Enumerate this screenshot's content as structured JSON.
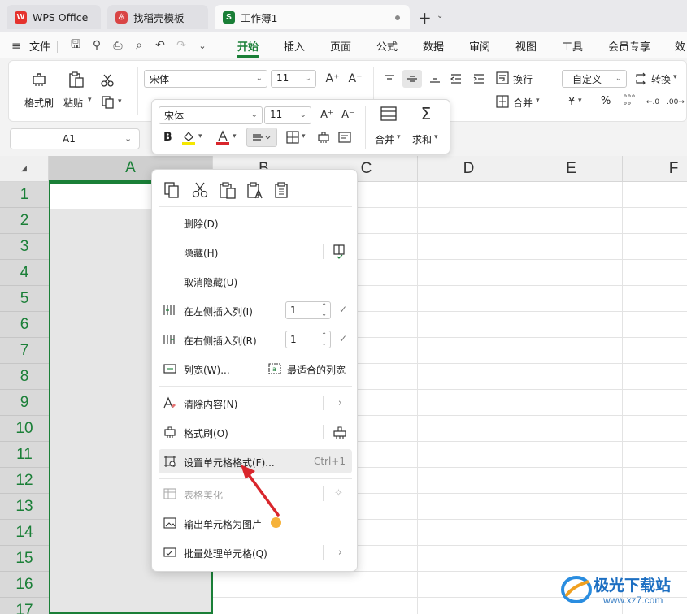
{
  "tabs": [
    {
      "label": "WPS Office"
    },
    {
      "label": "找稻壳模板"
    },
    {
      "label": "工作簿1"
    }
  ],
  "menu": {
    "file": "文件",
    "items": [
      "开始",
      "插入",
      "页面",
      "公式",
      "数据",
      "审阅",
      "视图",
      "工具",
      "会员专享",
      "效"
    ]
  },
  "ribbon": {
    "format_painter": "格式刷",
    "paste": "粘贴",
    "font_name": "宋体",
    "font_size": "11",
    "wrap": "换行",
    "merge": "合并",
    "number_format": "自定义",
    "convert": "转换",
    "yen": "¥",
    "percent": "%"
  },
  "namebox": {
    "value": "A1"
  },
  "grid": {
    "columns": [
      "A",
      "B",
      "C",
      "D",
      "E",
      "F"
    ],
    "rows": [
      "1",
      "2",
      "3",
      "4",
      "5",
      "6",
      "7",
      "8",
      "9",
      "10",
      "11",
      "12",
      "13",
      "14",
      "15",
      "16",
      "17"
    ]
  },
  "minibar": {
    "font_name": "宋体",
    "font_size": "11",
    "bold": "B",
    "merge": "合并",
    "sum": "求和"
  },
  "context_menu": {
    "delete": "删除(D)",
    "hide": "隐藏(H)",
    "unhide": "取消隐藏(U)",
    "insert_left": "在左侧插入列(I)",
    "insert_left_count": "1",
    "insert_right": "在右侧插入列(R)",
    "insert_right_count": "1",
    "col_width": "列宽(W)...",
    "best_fit": "最适合的列宽",
    "clear": "清除内容(N)",
    "format_painter": "格式刷(O)",
    "format_cells": "设置单元格格式(F)...",
    "format_cells_shortcut": "Ctrl+1",
    "table_beautify": "表格美化",
    "export_image": "输出单元格为图片",
    "batch": "批量处理单元格(Q)"
  },
  "watermark": {
    "title": "极光下载站",
    "url": "www.xz7.com"
  },
  "colors": {
    "accent": "#1a7f37",
    "arrow": "#d9262c"
  }
}
